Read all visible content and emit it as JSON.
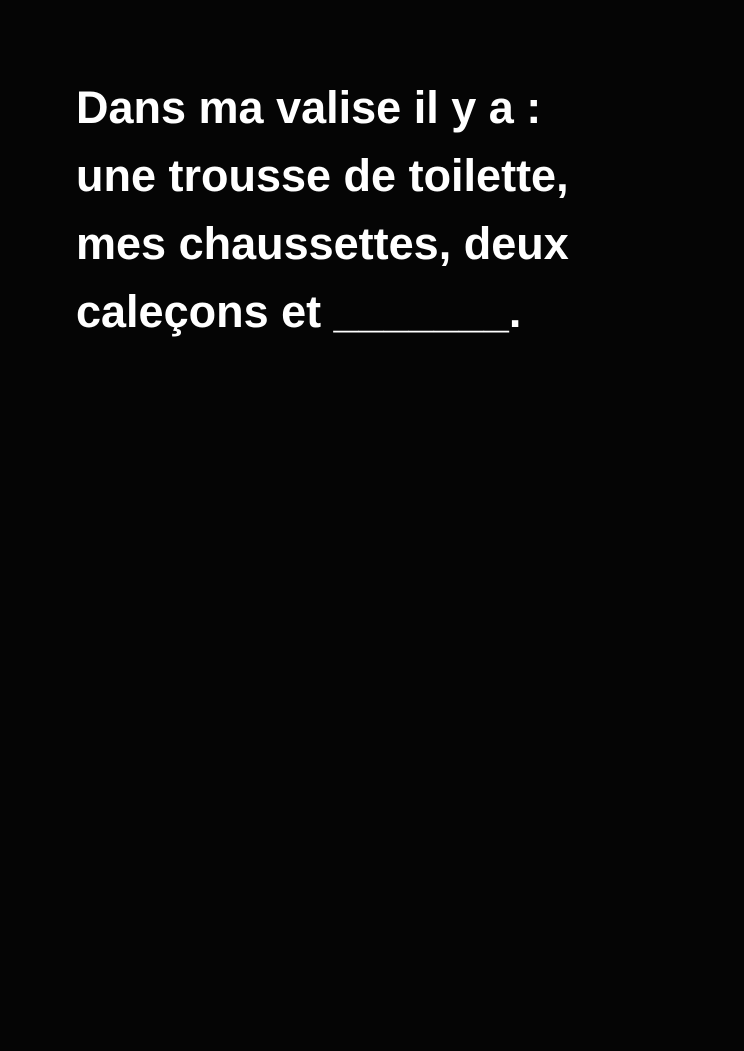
{
  "card": {
    "background_color": "#050505",
    "text_color": "#ffffff",
    "lines": [
      "Dans ma valise il y a :",
      "une trousse de toilette,",
      "mes chaussettes, deux",
      "caleçons et _______."
    ]
  }
}
